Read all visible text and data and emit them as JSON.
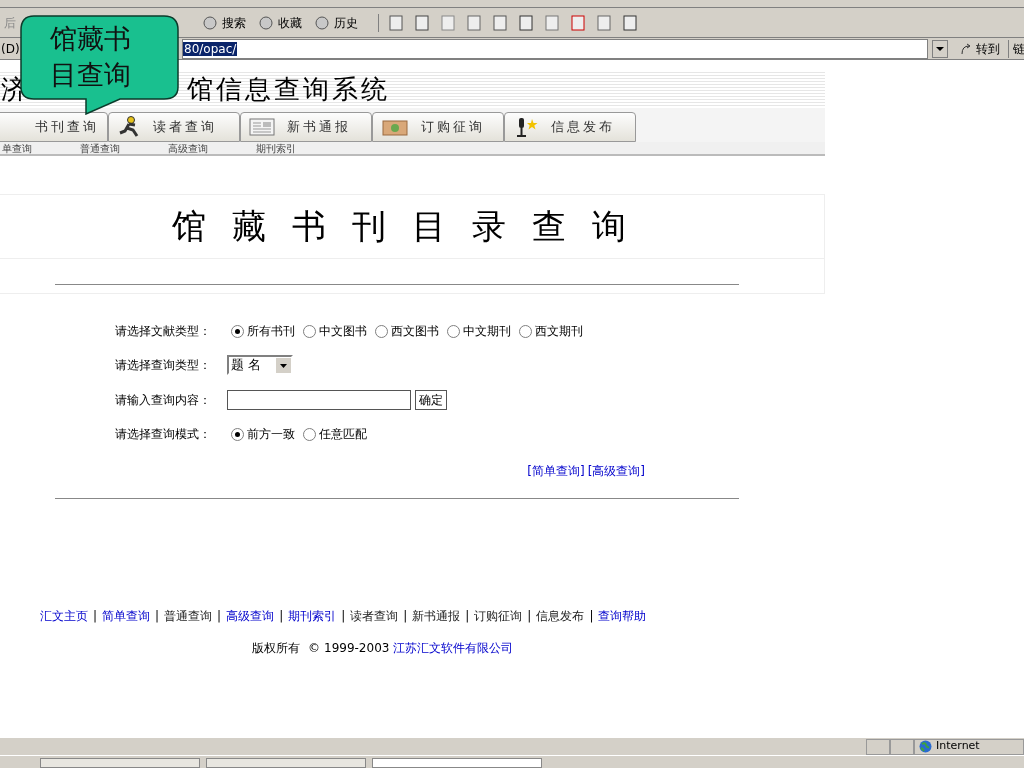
{
  "toolbar": {
    "back_label": "后",
    "buttons": [
      {
        "label": "搜索"
      },
      {
        "label": "收藏"
      },
      {
        "label": "历史"
      }
    ]
  },
  "address_bar": {
    "label": "(D)",
    "url": "80/opac/",
    "go": "转到",
    "links": "链"
  },
  "callout": {
    "text": "馆藏书目查询"
  },
  "banner": {
    "title_left": "济",
    "title_right": "馆信息查询系统"
  },
  "tabs": [
    {
      "label": "书刊查询"
    },
    {
      "label": "读者查询"
    },
    {
      "label": "新书通报"
    },
    {
      "label": "订购征询"
    },
    {
      "label": "信息发布"
    }
  ],
  "subnav": [
    "单查询",
    "普通查询",
    "高级查询",
    "期刊索引"
  ],
  "heading": "馆藏书刊目录查询",
  "form": {
    "doc_type": {
      "label": "请选择文献类型：",
      "options": [
        {
          "label": "所有书刊",
          "selected": true
        },
        {
          "label": "中文图书",
          "selected": false
        },
        {
          "label": "西文图书",
          "selected": false
        },
        {
          "label": "中文期刊",
          "selected": false
        },
        {
          "label": "西文期刊",
          "selected": false
        }
      ]
    },
    "query_type": {
      "label": "请选择查询类型：",
      "value": "题 名"
    },
    "content": {
      "label": "请输入查询内容：",
      "button": "确定"
    },
    "mode": {
      "label": "请选择查询模式：",
      "options": [
        {
          "label": "前方一致",
          "selected": true
        },
        {
          "label": "任意匹配",
          "selected": false
        }
      ]
    },
    "links": [
      "[简单查询]",
      "[高级查询]"
    ]
  },
  "footer": {
    "links": [
      {
        "label": "汇文主页",
        "visited": false
      },
      {
        "label": "简单查询",
        "visited": false
      },
      {
        "label": "普通查询",
        "visited": true
      },
      {
        "label": "高级查询",
        "visited": false
      },
      {
        "label": "期刊索引",
        "visited": false
      },
      {
        "label": "读者查询",
        "visited": true
      },
      {
        "label": "新书通报",
        "visited": true
      },
      {
        "label": "订购征询",
        "visited": true
      },
      {
        "label": "信息发布",
        "visited": true
      },
      {
        "label": "查询帮助",
        "visited": false
      }
    ],
    "separator": "|",
    "copyright": "版权所有",
    "copy_sign": "©",
    "years": "1999-2003",
    "company": "江苏汇文软件有限公司"
  },
  "status_bar": {
    "zone": "Internet"
  }
}
